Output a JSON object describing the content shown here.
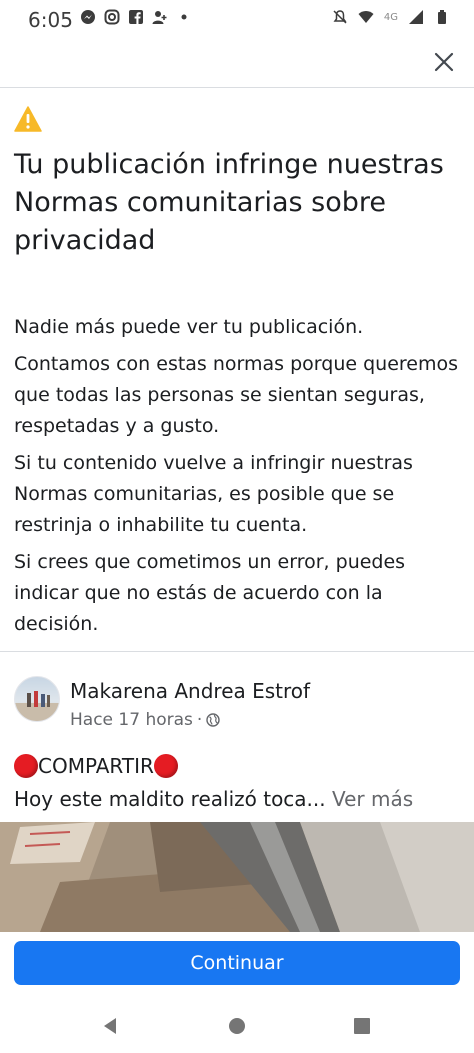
{
  "status_bar": {
    "time": "6:05",
    "network": "4G",
    "left_icons": [
      "messenger-icon",
      "instagram-icon",
      "facebook-icon",
      "people-icon",
      "dot-icon"
    ],
    "right_icons": [
      "mute-icon",
      "wifi-icon",
      "signal-icon",
      "battery-icon"
    ]
  },
  "dialog": {
    "title": "Tu publicación infringe nuestras Normas comunitarias sobre privacidad",
    "paragraphs": [
      "Nadie más puede ver tu publicación.",
      "Contamos con estas normas porque queremos que todas las personas se sientan seguras, respetadas y a gusto.",
      "Si tu contenido vuelve a infringir nuestras Normas comunitarias, es posible que se restrinja o inhabilite tu cuenta.",
      "Si crees que cometimos un error, puedes indicar que no estás de acuerdo con la decisión."
    ]
  },
  "post": {
    "author": "Makarena Andrea Estrof",
    "time": "Hace 17 horas",
    "separator": "·",
    "audience_icon": "globe-icon",
    "line1_text": "COMPARTIR",
    "line2_text": "Hoy este maldito realizó toca...",
    "see_more": "Ver más"
  },
  "actions": {
    "continue_label": "Continuar"
  },
  "colors": {
    "accent": "#1877f2",
    "warning": "#f7b928",
    "red_dot": "#e51c23",
    "secondary_text": "#65676b"
  }
}
